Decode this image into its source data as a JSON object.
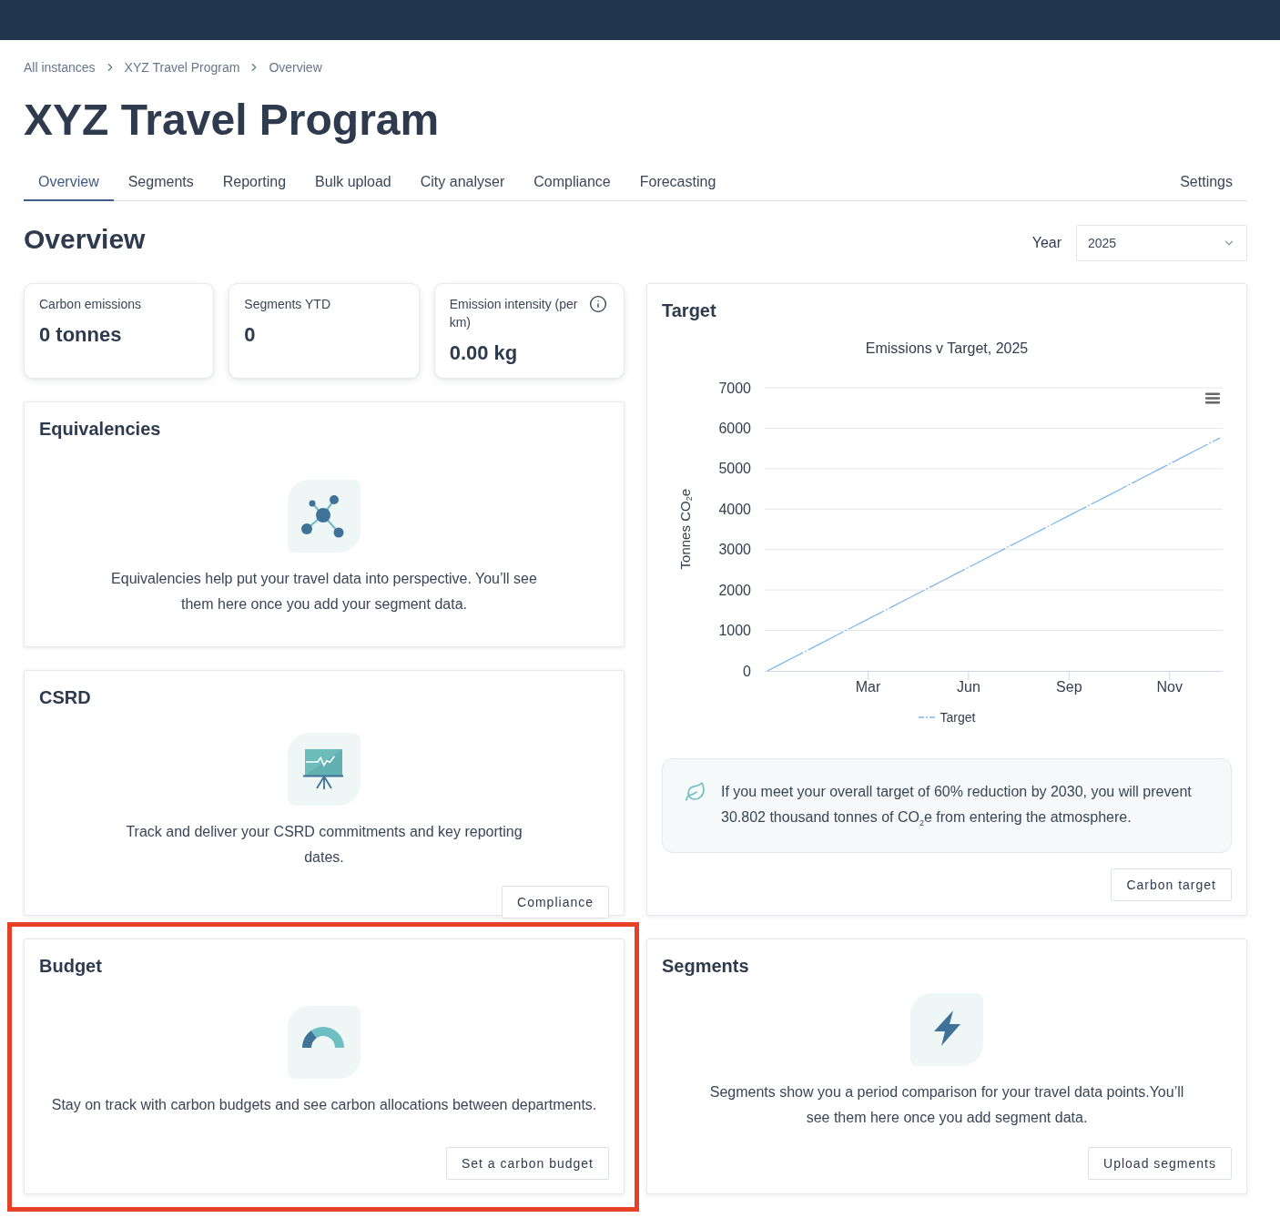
{
  "breadcrumbs": [
    {
      "label": "All instances"
    },
    {
      "label": "XYZ Travel Program"
    },
    {
      "label": "Overview"
    }
  ],
  "title": "XYZ Travel Program",
  "tabs": [
    {
      "label": "Overview",
      "selected": true
    },
    {
      "label": "Segments",
      "selected": false
    },
    {
      "label": "Reporting",
      "selected": false
    },
    {
      "label": "Bulk upload",
      "selected": false
    },
    {
      "label": "City analyser",
      "selected": false
    },
    {
      "label": "Compliance",
      "selected": false
    },
    {
      "label": "Forecasting",
      "selected": false
    }
  ],
  "settings_tab": {
    "label": "Settings",
    "selected": false
  },
  "section": {
    "heading": "Overview",
    "year": {
      "label": "Year",
      "value": "2025"
    }
  },
  "stats": [
    {
      "label": "Carbon emissions",
      "value": "0 tonnes",
      "info": false
    },
    {
      "label": "Segments YTD",
      "value": "0",
      "info": false
    },
    {
      "label": "Emission intensity (per km)",
      "value": "0.00 kg",
      "info": true
    }
  ],
  "equivalencies_card": {
    "title": "Equivalencies",
    "text": "Equivalencies help put your travel data into perspective. You’ll see them here once you add your segment data."
  },
  "csrd_card": {
    "title": "CSRD",
    "text": "Track and deliver your CSRD commitments and key reporting dates.",
    "button": "Compliance"
  },
  "budget_card": {
    "title": "Budget",
    "text": "Stay on track with carbon budgets and see carbon allocations between departments.",
    "button": "Set a carbon budget",
    "highlighted": true
  },
  "target_card": {
    "title": "Target",
    "chart_data": {
      "type": "line",
      "title": "Emissions v Target, 2025",
      "ylabel": "Tonnes CO$_{2}$e",
      "grid": true,
      "categories": [
        null,
        null,
        null,
        null,
        null,
        null,
        null,
        null,
        "Mar",
        null,
        null,
        null,
        null,
        null,
        null,
        null,
        "Jun",
        null,
        null,
        null,
        null,
        null,
        null,
        null,
        "Sep",
        null,
        null,
        null,
        null,
        null,
        null,
        null,
        "Nov",
        null,
        null,
        null,
        null
      ],
      "series": [
        {
          "name": "Target",
          "color": "#7cb5ec",
          "line_style": "dashdot",
          "values": [
            0,
            160,
            320,
            480,
            640,
            800,
            960,
            1120,
            1280,
            1440,
            1600,
            1760,
            1920,
            2080,
            2240,
            2400,
            2560,
            2720,
            2880,
            3040,
            3200,
            3360,
            3520,
            3680,
            3840,
            4000,
            4160,
            4320,
            4480,
            4640,
            4800,
            4960,
            5120,
            5280,
            5440,
            5600,
            5760
          ]
        }
      ],
      "ylim": [
        0,
        7000
      ],
      "yticks": [
        0,
        1000,
        2000,
        3000,
        4000,
        5000,
        6000,
        7000
      ]
    },
    "callout": "If you meet your overall target of 60% reduction by 2030, you will prevent 30.802 thousand tonnes of CO$_{2}$e from entering the atmosphere.",
    "button": "Carbon target"
  },
  "segments_card": {
    "title": "Segments",
    "text": "Segments show you a period comparison for your travel data points.You’ll see them here once you add segment data.",
    "button": "Upload segments"
  }
}
